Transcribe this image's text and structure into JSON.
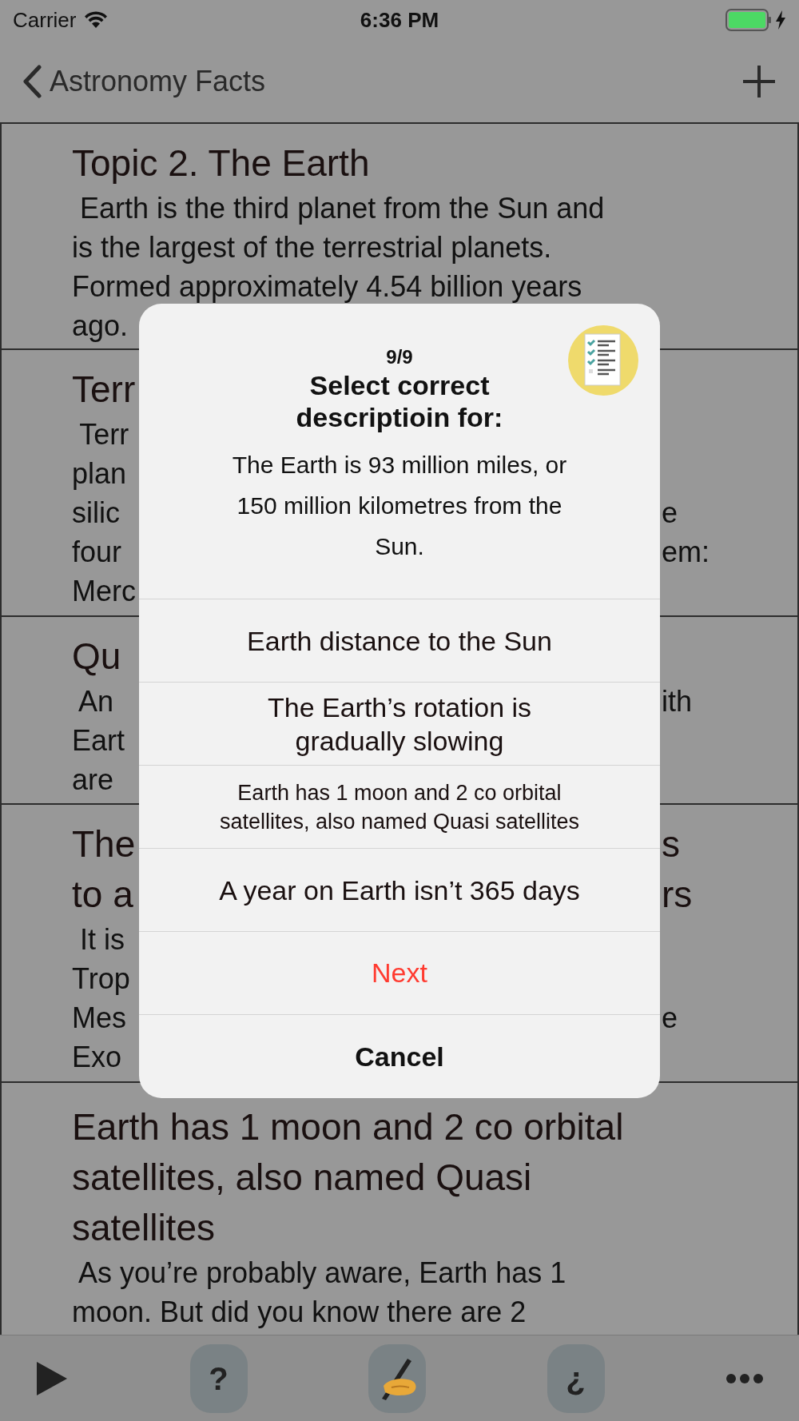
{
  "status_bar": {
    "carrier": "Carrier",
    "time": "6:36 PM",
    "charging": true
  },
  "nav_bar": {
    "back_label": "Astronomy Facts"
  },
  "rows": [
    {
      "title_lines": [
        {
          "left": "Topic 2. The Earth"
        }
      ],
      "body_lines": [
        {
          "left": " Earth is the third planet from the Sun and"
        },
        {
          "left": "is the largest of the terrestrial planets."
        },
        {
          "left": "Formed approximately 4.54 billion years"
        },
        {
          "left": "ago."
        }
      ]
    },
    {
      "title_lines": [
        {
          "left": "Terr"
        }
      ],
      "body_lines": [
        {
          "left": " Terr"
        },
        {
          "left": "plan"
        },
        {
          "left": "silic",
          "right": "e"
        },
        {
          "left": "four",
          "right": "em:"
        },
        {
          "left": "Merc"
        }
      ]
    },
    {
      "title_lines": [
        {
          "left": "Qu"
        }
      ],
      "body_lines": [
        {
          "left": " An",
          "right": "ith"
        },
        {
          "left": "Eart"
        },
        {
          "left": "are"
        }
      ]
    },
    {
      "title_lines": [
        {
          "left": "The",
          "right": "s"
        },
        {
          "left": "to a",
          "right": "rs"
        }
      ],
      "body_lines": [
        {
          "left": " It is"
        },
        {
          "left": "Trop"
        },
        {
          "left": "Mes",
          "right": "e"
        },
        {
          "left": "Exo"
        }
      ]
    },
    {
      "title_lines": [
        {
          "left": "Earth has 1 moon and 2 co orbital"
        },
        {
          "left": "satellites, also named Quasi"
        },
        {
          "left": "satellites"
        }
      ],
      "body_lines": [
        {
          "left": " As you’re probably aware, Earth has 1"
        },
        {
          "left": "moon. But did you know there are 2"
        }
      ]
    }
  ],
  "alert": {
    "counter": "9/9",
    "title": "Select correct descriptioin for:",
    "message": "The Earth is 93 million miles, or 150 million kilometres from the Sun.",
    "options": [
      {
        "kind": "answer",
        "label": "Earth distance to the Sun"
      },
      {
        "kind": "answer",
        "label": "The Earth’s rotation is gradually slowing"
      },
      {
        "kind": "answer",
        "label": "Earth has 1 moon and 2 co orbital satellites, also named Quasi satellites"
      },
      {
        "kind": "answer",
        "label": "A year on Earth isn’t 365 days"
      },
      {
        "kind": "next",
        "label": "Next"
      },
      {
        "kind": "cancel",
        "label": "Cancel"
      }
    ]
  },
  "toolbar": [
    {
      "kind": "play"
    },
    {
      "kind": "text",
      "label": "?"
    },
    {
      "kind": "writing"
    },
    {
      "kind": "text",
      "label": "¿"
    },
    {
      "kind": "more"
    }
  ]
}
